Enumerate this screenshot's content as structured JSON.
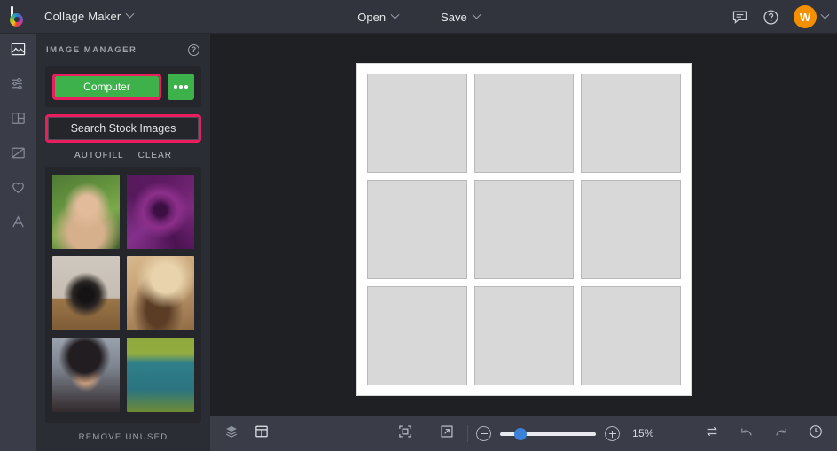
{
  "topbar": {
    "logo_icon": "befunky-logo-icon",
    "app_title": "Collage Maker",
    "app_title_caret": "chevron-down-icon",
    "open_label": "Open",
    "save_label": "Save",
    "feedback_icon": "chat-bubble-icon",
    "help_icon": "question-circle-icon",
    "avatar_initial": "W",
    "avatar_caret_icon": "chevron-down-icon",
    "avatar_color": "#f49000"
  },
  "rail": {
    "items": [
      {
        "name": "image-manager",
        "icon": "photo-icon",
        "active": true
      },
      {
        "name": "edit-adjust",
        "icon": "sliders-icon",
        "active": false
      },
      {
        "name": "layouts",
        "icon": "layout-grid-icon",
        "active": false
      },
      {
        "name": "graphics",
        "icon": "graphic-shape-icon",
        "active": false
      },
      {
        "name": "favorites",
        "icon": "heart-icon",
        "active": false
      },
      {
        "name": "text",
        "icon": "text-a-icon",
        "active": false
      }
    ]
  },
  "panel": {
    "title": "IMAGE MANAGER",
    "help_icon": "question-mark-icon",
    "computer_label": "Computer",
    "more_options_icon": "ellipsis-icon",
    "search_stock_label": "Search Stock Images",
    "autofill_label": "AUTOFILL",
    "clear_label": "CLEAR",
    "remove_unused_label": "REMOVE UNUSED",
    "highlight_color": "#ea1e5f",
    "computer_button_color": "#3db14a",
    "thumbnails": [
      {
        "name": "thumb-woman-green-hedge",
        "c1": "#6d8a4a",
        "c2": "#c9a27a",
        "c3": "#3f5a28"
      },
      {
        "name": "thumb-purple-flower",
        "c1": "#e9e6e8",
        "c2": "#6b1d6e",
        "c3": "#3a0f3e"
      },
      {
        "name": "thumb-vintage-camera",
        "c1": "#cfc7bd",
        "c2": "#2b2724",
        "c3": "#8a6a47"
      },
      {
        "name": "thumb-woman-straw-hat",
        "c1": "#c9a878",
        "c2": "#e3c59a",
        "c3": "#6b4b2e"
      },
      {
        "name": "thumb-woman-black-hat",
        "c1": "#8d94a0",
        "c2": "#2a2529",
        "c3": "#b08a6d"
      },
      {
        "name": "thumb-teal-vintage-truck",
        "c1": "#8fa83c",
        "c2": "#2f7f8a",
        "c3": "#7d9a3c"
      }
    ]
  },
  "canvas": {
    "board_cells": [
      "cell-1",
      "cell-2",
      "cell-3",
      "cell-4",
      "cell-5",
      "cell-6",
      "cell-7",
      "cell-8",
      "cell-9"
    ],
    "board_background": "#ffffff",
    "cell_color": "#d8d8d8"
  },
  "bottombar": {
    "layers_icon": "layers-icon",
    "layout_icon": "layout-panel-icon",
    "fit_screen_icon": "fit-to-screen-icon",
    "expand_icon": "expand-arrow-icon",
    "zoom_out_icon": "minus-circle-icon",
    "zoom_in_icon": "plus-circle-icon",
    "zoom_value": "15%",
    "slider_percent": 15,
    "swap_icon": "swap-arrows-icon",
    "undo_icon": "undo-arrow-icon",
    "redo_icon": "redo-arrow-icon",
    "history_icon": "history-clock-icon",
    "slider_knob_color": "#3b82d8"
  }
}
